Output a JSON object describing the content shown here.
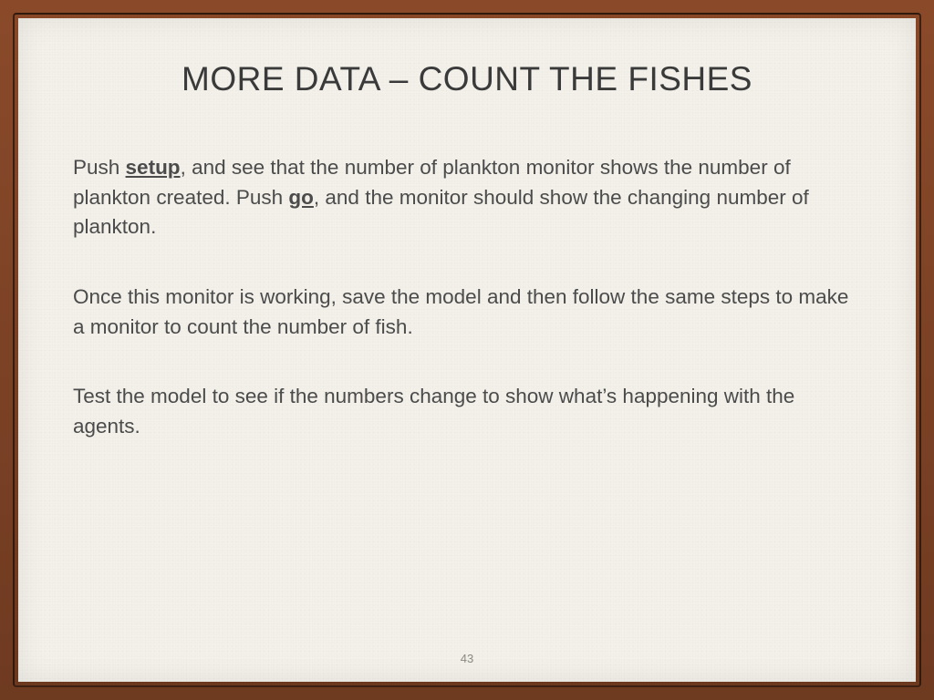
{
  "title": "MORE DATA – COUNT THE FISHES",
  "paragraphs": {
    "p1_a": "Push ",
    "p1_setup": "setup",
    "p1_b": ", and see that the number of plankton monitor shows the number of plankton created.  Push ",
    "p1_go": "go",
    "p1_c": ", and the monitor should show the changing number of plankton.",
    "p2": "Once this monitor is working, save the model and then follow the same steps to make a monitor to count the number of fish.",
    "p3": "Test the model to see if the numbers change to show what’s happening with the agents."
  },
  "page_number": "43"
}
